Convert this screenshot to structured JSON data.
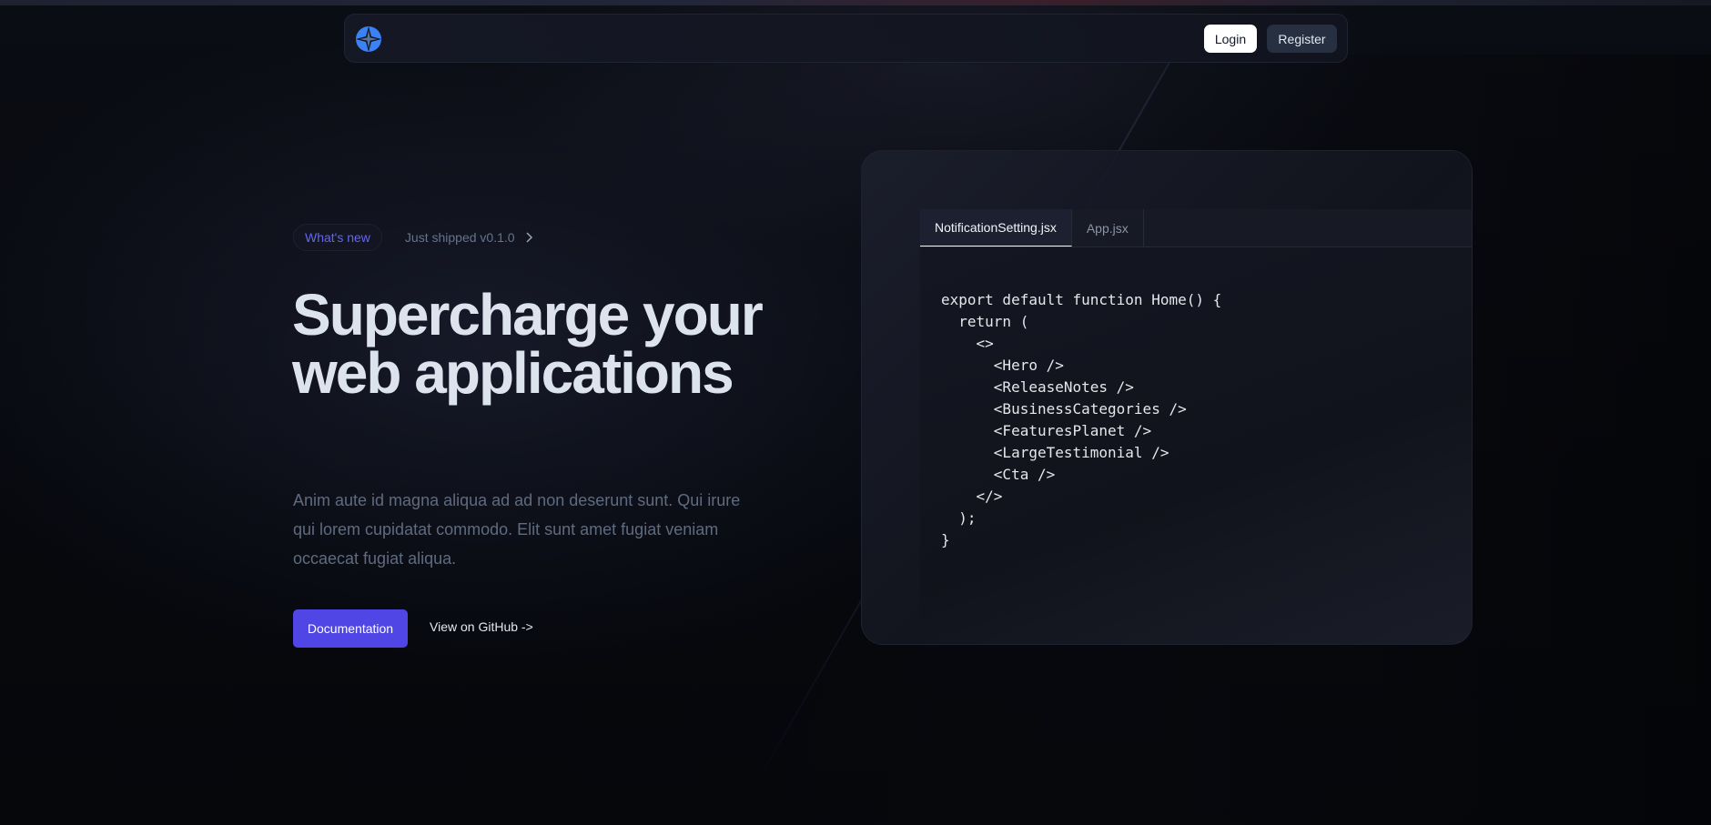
{
  "navbar": {
    "logo_icon": "logo-icon",
    "login_label": "Login",
    "register_label": "Register"
  },
  "hero": {
    "badge_label": "What's new",
    "badge_text": "Just shipped v0.1.0",
    "headline": "Supercharge your web applications",
    "subtext": "Anim aute id magna aliqua ad ad non deserunt sunt. Qui irure qui lorem cupidatat commodo. Elit sunt amet fugiat veniam occaecat fugiat aliqua.",
    "primary_button": "Documentation",
    "secondary_link": "View on GitHub ->"
  },
  "code_window": {
    "tabs": [
      {
        "label": "NotificationSetting.jsx",
        "active": true
      },
      {
        "label": "App.jsx",
        "active": false
      }
    ],
    "code": "export default function Home() {\n  return (\n    <>\n      <Hero />\n      <ReleaseNotes />\n      <BusinessCategories />\n      <FeaturesPlanet />\n      <LargeTestimonial />\n      <Cta />\n    </>\n  );\n}"
  },
  "colors": {
    "background": "#05070b",
    "accent": "#4f46e5",
    "badge_accent": "#6366f1",
    "headline": "#dde3ed",
    "muted_text": "#5f6b7e"
  }
}
